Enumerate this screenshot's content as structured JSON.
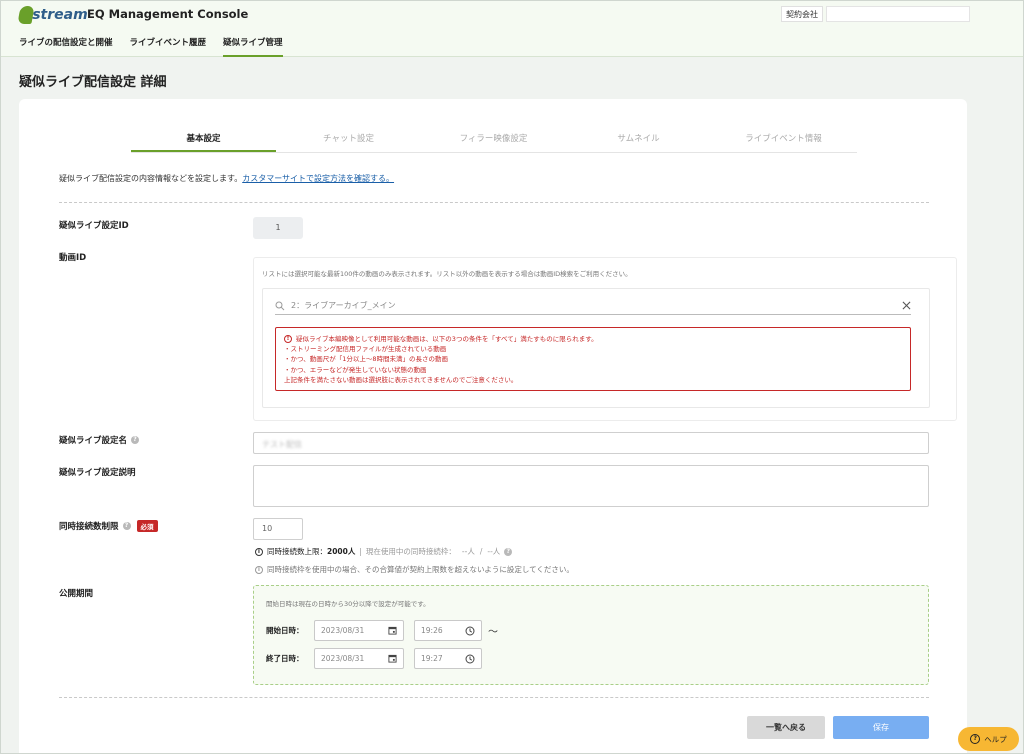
{
  "header": {
    "logo_text": "Jstream",
    "app_title": "EQ Management Console",
    "contract_label": "契約会社",
    "contract_value": ""
  },
  "nav": {
    "items": [
      {
        "label": "ライブの配信設定と開催"
      },
      {
        "label": "ライブイベント履歴"
      },
      {
        "label": "疑似ライブ管理"
      }
    ],
    "active_index": 2
  },
  "page": {
    "title": "疑似ライブ配信設定 詳細"
  },
  "tabs": [
    {
      "label": "基本設定"
    },
    {
      "label": "チャット設定"
    },
    {
      "label": "フィラー映像設定"
    },
    {
      "label": "サムネイル"
    },
    {
      "label": "ライブイベント情報"
    }
  ],
  "description": {
    "text": "疑似ライブ配信設定の内容情報などを設定します。",
    "link": "カスタマーサイトで設定方法を確認する。"
  },
  "form": {
    "setting_id": {
      "label": "疑似ライブ設定ID",
      "value": "1"
    },
    "video_id": {
      "label": "動画ID",
      "note": "リストには選択可能な最新100件の動画のみ表示されます。リスト以外の動画を表示する場合は動画ID検索をご利用ください。",
      "search_value": "2：ライブアーカイブ_メイン",
      "warning_title": "疑似ライブ本編映像として利用可能な動画は、以下の3つの条件を「すべて」満たすものに限られます。",
      "warning_lines": [
        "・ストリーミング配信用ファイルが生成されている動画",
        "・かつ、動画尺が「1分以上～8時間未満」の長さの動画",
        "・かつ、エラーなどが発生していない状態の動画",
        "上記条件を満たさない動画は選択肢に表示されてきませんのでご注意ください。"
      ]
    },
    "setting_name": {
      "label": "疑似ライブ設定名",
      "value": "テスト配信"
    },
    "setting_description": {
      "label": "疑似ライブ設定説明",
      "value": ""
    },
    "concurrent_limit": {
      "label": "同時接続数制限",
      "required_badge": "必須",
      "value": "10",
      "limit_text": "同時接続数上限：",
      "limit_value": "2000人",
      "in_use_text": "現在使用中の同時接続枠：",
      "in_use_value": "--人",
      "separator": "/",
      "in_use_total": "--人",
      "note": "同時接続枠を使用中の場合、その合算値が契約上限数を超えないように設定してください。"
    },
    "period": {
      "label": "公開期間",
      "note": "開始日時は現在の日時から30分以降で設定が可能です。",
      "start_label": "開始日時：",
      "start_date": "2023/08/31",
      "start_time": "19:26",
      "tilde": "～",
      "end_label": "終了日時：",
      "end_date": "2023/08/31",
      "end_time": "19:27"
    }
  },
  "buttons": {
    "back": "一覧へ戻る",
    "save": "保存"
  },
  "help": {
    "label": "ヘルプ"
  },
  "colors": {
    "accent": "#6aa02a",
    "warning": "#c62828",
    "save": "#78aef2",
    "help": "#f7b733",
    "link": "#1a5fa8"
  }
}
